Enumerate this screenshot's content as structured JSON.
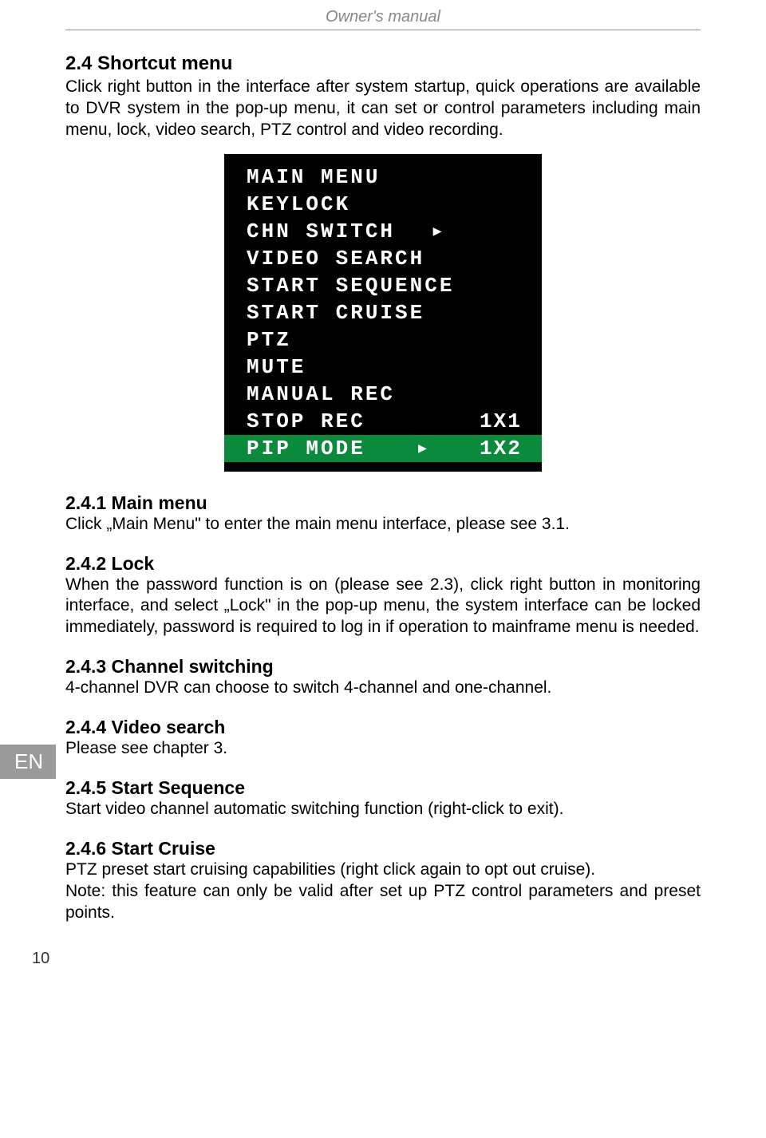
{
  "header": "Owner's manual",
  "lang_tab": "EN",
  "page_number": "10",
  "sec24": {
    "title": "2.4 Shortcut menu",
    "body": "Click right button in the interface after system startup, quick operations are available to DVR system in the pop-up menu, it can set or control parameters including main menu, lock, video search, PTZ control and video recording."
  },
  "menu": {
    "items": [
      {
        "label": "MAIN MENU",
        "arrow": "",
        "right": "",
        "selected": false
      },
      {
        "label": "KEYLOCK",
        "arrow": "",
        "right": "",
        "selected": false
      },
      {
        "label": "CHN SWITCH",
        "arrow": "▶",
        "right": "",
        "selected": false
      },
      {
        "label": "VIDEO SEARCH",
        "arrow": "",
        "right": "",
        "selected": false
      },
      {
        "label": "START SEQUENCE",
        "arrow": "",
        "right": "",
        "selected": false
      },
      {
        "label": "START CRUISE",
        "arrow": "",
        "right": "",
        "selected": false
      },
      {
        "label": "PTZ",
        "arrow": "",
        "right": "",
        "selected": false
      },
      {
        "label": "MUTE",
        "arrow": "",
        "right": "",
        "selected": false
      },
      {
        "label": "MANUAL REC",
        "arrow": "",
        "right": "",
        "selected": false
      },
      {
        "label": "STOP REC",
        "arrow": "",
        "right": "1X1",
        "selected": false
      },
      {
        "label": "PIP MODE",
        "arrow": "▶",
        "right": "1X2",
        "selected": true
      }
    ]
  },
  "sec241": {
    "title": "2.4.1 Main menu",
    "body": "Click „Main Menu\" to enter the main menu interface, please see 3.1."
  },
  "sec242": {
    "title": "2.4.2 Lock",
    "body": "When the password function is on (please see 2.3), click right button in monitoring interface, and select „Lock\" in the pop-up menu, the system interface can be locked immediately, password is required to log in if operation to mainframe menu is needed."
  },
  "sec243": {
    "title": "2.4.3 Channel switching",
    "body": "4-channel DVR can choose to switch 4-channel and one-channel."
  },
  "sec244": {
    "title": "2.4.4 Video search",
    "body": "Please see chapter 3."
  },
  "sec245": {
    "title": "2.4.5 Start Sequence",
    "body": "Start video channel automatic switching function (right-click to exit)."
  },
  "sec246": {
    "title": "2.4.6 Start Cruise",
    "body1": "PTZ preset start cruising capabilities (right click again to opt out cruise).",
    "body2": "Note: this feature can only be valid after set up PTZ control parameters and preset points."
  }
}
